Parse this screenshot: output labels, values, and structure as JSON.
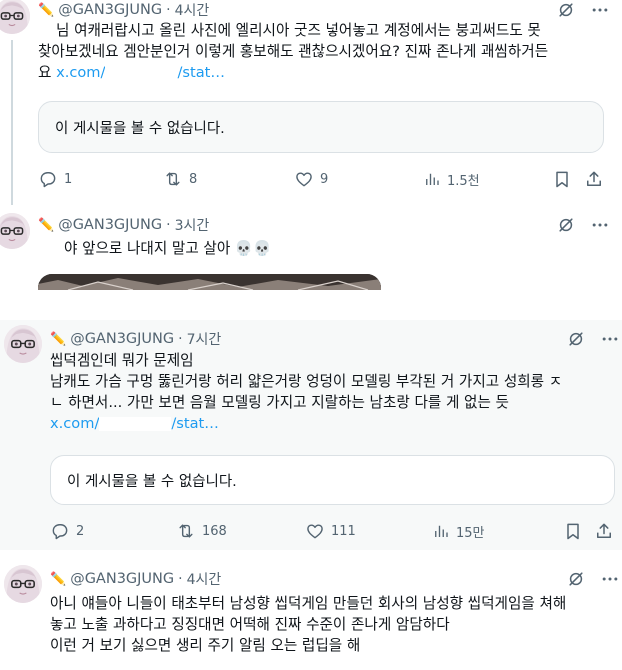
{
  "posts": [
    {
      "handle": "@GAN3GJUNG",
      "time": "4시간",
      "text_line1": "님 여캐러랍시고 올린 사진에 엘리시아 굿즈 넣어놓고 계정에서는 붕괴써드도 못",
      "text_line2": "찾아보겠네요 겜안분인거 이렇게 홍보해도 괜찮으시겠어요? 진짜 존나게 괘씸하거든",
      "text_line3_prefix": "요 ",
      "link_start": "x.com/",
      "link_end": "/stat…",
      "quote": "이 게시물을 볼 수 없습니다.",
      "replies": "1",
      "reposts": "8",
      "likes": "9",
      "views": "1.5천"
    },
    {
      "handle": "@GAN3GJUNG",
      "time": "3시간",
      "text": "야 앞으로 나대지 말고 살아 💀💀"
    },
    {
      "handle": "@GAN3GJUNG",
      "time": "7시간",
      "text_line1": "씹덕겜인데 뭐가 문제임",
      "text_line2": "남캐도 가슴 구멍 뚫린거랑 허리 얇은거랑 엉덩이 모델링 부각된 거 가지고 성희롱 ㅈ",
      "text_line3": "ㄴ 하면서... 가만 보면 음월 모델링 가지고 지랄하는 남초랑 다를 게 없는 듯",
      "link_start": "x.com/",
      "link_end": "/stat…",
      "quote": "이 게시물을 볼 수 없습니다.",
      "replies": "2",
      "reposts": "168",
      "likes": "111",
      "views": "15만"
    },
    {
      "handle": "@GAN3GJUNG",
      "time": "4시간",
      "text_line1": "아니 얘들아 니들이 태초부터 남성향 씹덕게임 만들던 회사의 남성향 씹덕게임을 쳐해",
      "text_line2": "놓고 노출 과하다고 징징대면 어떡해 진짜 수준이 존나게 암담하다",
      "text_line3": "이런 거 보기 싫으면 생리 주기 알림 오는 럽딥을 해"
    }
  ],
  "icons": {
    "grok": "grok-slash-icon",
    "more": "more-dots-icon",
    "reply": "reply-bubble-icon",
    "repost": "repost-arrows-icon",
    "like": "heart-icon",
    "views": "views-bars-icon",
    "bookmark": "bookmark-icon",
    "share": "share-icon"
  },
  "colors": {
    "link": "#1d9bf0",
    "secondary": "#536471",
    "text": "#0f1419",
    "border": "#dbe1e5"
  }
}
